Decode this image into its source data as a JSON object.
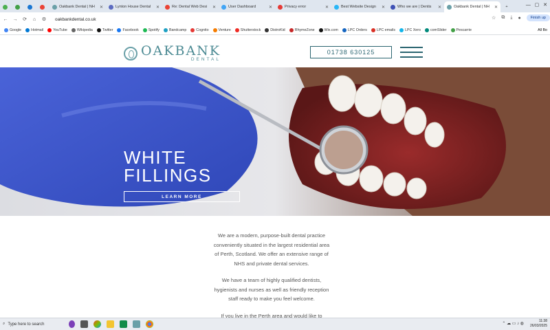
{
  "browser": {
    "tabs": [
      {
        "title": "",
        "active": false,
        "color": "#4caf50"
      },
      {
        "title": "",
        "active": false,
        "color": "#43a047"
      },
      {
        "title": "",
        "active": false,
        "color": "#1976d2"
      },
      {
        "title": "",
        "active": false,
        "color": "#ea4335"
      },
      {
        "title": "Oakbank Dental | NH",
        "active": false,
        "color": "#6aa0a8"
      },
      {
        "title": "Lynton House Dental",
        "active": false,
        "color": "#5c6bc0"
      },
      {
        "title": "Re: Dental Web Desi",
        "active": false,
        "color": "#ea4335"
      },
      {
        "title": "User Dashboard",
        "active": false,
        "color": "#42a5f5"
      },
      {
        "title": "Privacy error",
        "active": false,
        "color": "#e53935"
      },
      {
        "title": "Best Website Design",
        "active": false,
        "color": "#29b6f6"
      },
      {
        "title": "Who we are | Dentis",
        "active": false,
        "color": "#3f51b5"
      },
      {
        "title": "Oakbank Dental | NH",
        "active": true,
        "color": "#6aa0a8"
      }
    ],
    "url": "oakbankdental.co.uk",
    "finish_label": "Finish up",
    "bookmarks": [
      {
        "label": "Google",
        "color": "#4285f4"
      },
      {
        "label": "Hotmail",
        "color": "#0078d4"
      },
      {
        "label": "YouTube",
        "color": "#ff0000"
      },
      {
        "label": "Wikipedia",
        "color": "#666666"
      },
      {
        "label": "Twitter",
        "color": "#111111"
      },
      {
        "label": "Facebook",
        "color": "#1877f2"
      },
      {
        "label": "Spotify",
        "color": "#1db954"
      },
      {
        "label": "Bandcamp",
        "color": "#1da0c3"
      },
      {
        "label": "Cognito",
        "color": "#e53935"
      },
      {
        "label": "Venture",
        "color": "#f57c00"
      },
      {
        "label": "Shutterstock",
        "color": "#ee2b24"
      },
      {
        "label": "DistroKid",
        "color": "#333333"
      },
      {
        "label": "RhymeZone",
        "color": "#c62828"
      },
      {
        "label": "Wix.com",
        "color": "#111111"
      },
      {
        "label": "LPC Orders",
        "color": "#1565c0"
      },
      {
        "label": "LPC emails",
        "color": "#d93025"
      },
      {
        "label": "LPC Xero",
        "color": "#13b5ea"
      },
      {
        "label": "comSlider",
        "color": "#00897b"
      },
      {
        "label": "Pescarrie",
        "color": "#43a047"
      }
    ],
    "all_bookmarks": "All Bo"
  },
  "site": {
    "logo_main": "OAKBANK",
    "logo_sub": "DENTAL",
    "phone": "01738 630125",
    "hero_title_1": "WHITE",
    "hero_title_2": "FILLINGS",
    "hero_button": "LEARN MORE",
    "paragraphs": [
      "We are a modern, purpose-built dental practice conveniently situated in the largest residential area of Perth, Scotland. We offer an extensive range of NHS and private dental services.",
      "We have a team of highly qualified dentists, hygienists and nurses as well as friendly reception staff ready to make you feel welcome.",
      "If you live in the Perth area and would like to"
    ]
  },
  "taskbar": {
    "search_placeholder": "Type here to search",
    "time": "11:38",
    "date": "26/03/2025"
  }
}
